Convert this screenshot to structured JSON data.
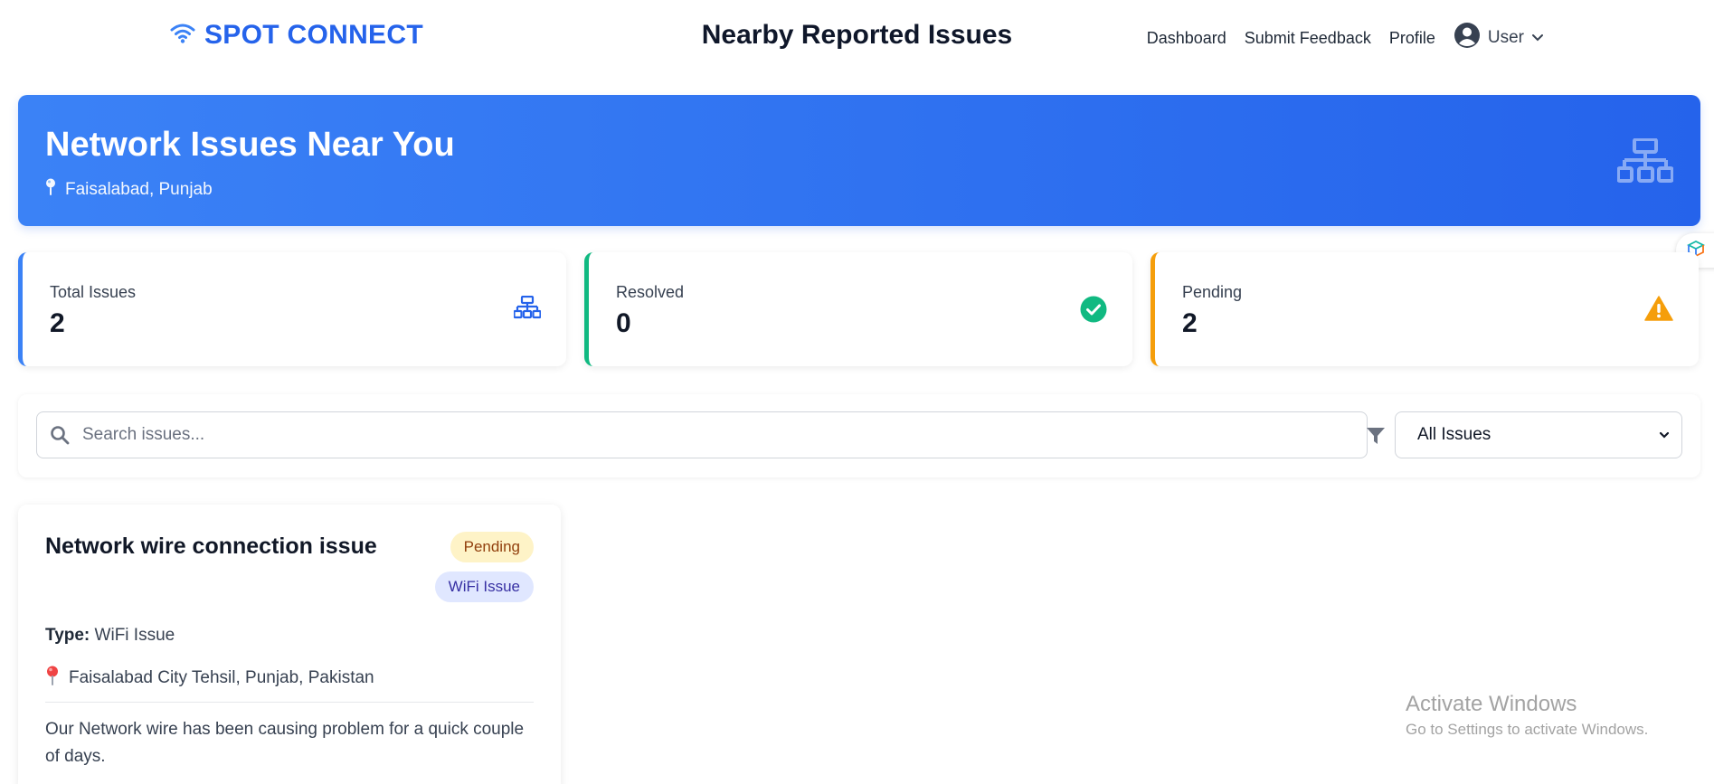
{
  "navbar": {
    "brand": "SPOT CONNECT",
    "title": "Nearby Reported Issues",
    "links": [
      "Dashboard",
      "Submit Feedback",
      "Profile"
    ],
    "user_label": "User"
  },
  "hero": {
    "title": "Network Issues Near You",
    "location": "Faisalabad, Punjab"
  },
  "stats": [
    {
      "label": "Total Issues",
      "value": "2",
      "color": "#3b82f6",
      "icon": "network-icon"
    },
    {
      "label": "Resolved",
      "value": "0",
      "color": "#10b981",
      "icon": "check-circle-icon"
    },
    {
      "label": "Pending",
      "value": "2",
      "color": "#f59e0b",
      "icon": "warning-icon"
    }
  ],
  "filters": {
    "search_placeholder": "Search issues...",
    "search_value": "",
    "selected_filter": "All Issues"
  },
  "issues": [
    {
      "title": "Network wire connection issue",
      "status": "Pending",
      "category": "WiFi Issue",
      "type_label": "Type:",
      "type_value": "WiFi Issue",
      "location": "Faisalabad City Tehsil, Punjab, Pakistan",
      "description": "Our Network wire has been causing problem for a quick couple of days."
    }
  ],
  "watermark": {
    "title": "Activate Windows",
    "subtitle": "Go to Settings to activate Windows."
  },
  "colors": {
    "brand": "#2563eb",
    "hero_start": "#3b82f6",
    "hero_end": "#2563eb",
    "pending_badge_bg": "#fef3c7",
    "category_badge_bg": "#e0e7ff"
  }
}
